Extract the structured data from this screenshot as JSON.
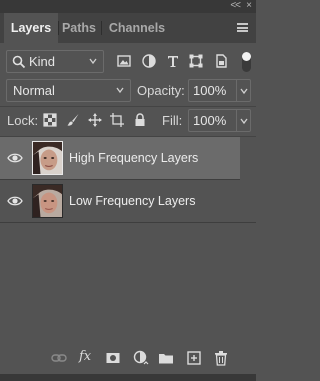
{
  "window": {
    "collapse_label": "<<",
    "close_label": "×"
  },
  "tabs": [
    {
      "label": "Layers",
      "active": true
    },
    {
      "label": "Paths",
      "active": false
    },
    {
      "label": "Channels",
      "active": false
    }
  ],
  "filter": {
    "kind_label": "Kind",
    "filter_icons": [
      "image-filter-icon",
      "adjustment-filter-icon",
      "type-filter-icon",
      "shape-filter-icon",
      "smart-object-filter-icon"
    ]
  },
  "blend": {
    "mode": "Normal",
    "opacity_label": "Opacity:",
    "opacity_value": "100%"
  },
  "lock": {
    "label": "Lock:",
    "icons": [
      "lock-transparent-pixels-icon",
      "lock-image-pixels-icon",
      "lock-position-icon",
      "lock-artboard-icon",
      "lock-all-icon"
    ],
    "fill_label": "Fill:",
    "fill_value": "100%"
  },
  "layers": [
    {
      "name": "High Frequency Layers",
      "visible": true,
      "selected": true
    },
    {
      "name": "Low Frequency Layers",
      "visible": true,
      "selected": false
    }
  ],
  "bottom_icons": [
    "link-layers-icon",
    "fx-icon",
    "add-mask-icon",
    "new-adjustment-layer-icon",
    "new-group-icon",
    "new-layer-icon",
    "delete-layer-icon"
  ],
  "bottom_fx_label": "fx",
  "colors": {
    "panel": "#535353",
    "tabbar": "#424242",
    "selected_row": "#6b6b6b",
    "text": "#ececec"
  }
}
